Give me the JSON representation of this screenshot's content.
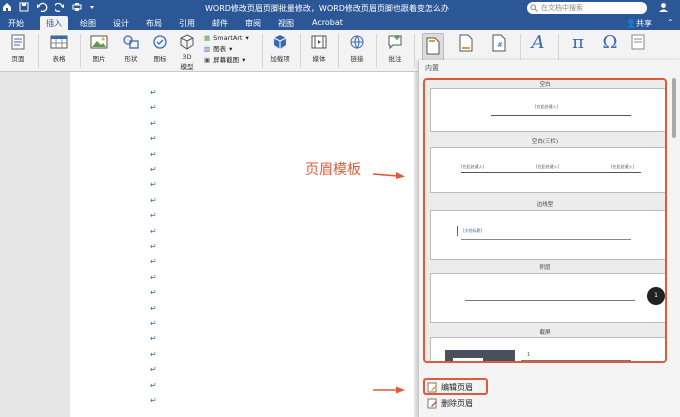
{
  "window": {
    "title": "WORD修改页眉页脚批量修改，WORD修改页眉页脚也跟着变怎么办"
  },
  "search": {
    "placeholder": "在文档中搜索"
  },
  "account": {
    "share_label": "共享"
  },
  "tabs": [
    {
      "label": "开始"
    },
    {
      "label": "插入"
    },
    {
      "label": "绘图"
    },
    {
      "label": "设计"
    },
    {
      "label": "布局"
    },
    {
      "label": "引用"
    },
    {
      "label": "邮件"
    },
    {
      "label": "审阅"
    },
    {
      "label": "视图"
    },
    {
      "label": "Acrobat"
    }
  ],
  "ribbon": {
    "page": "页面",
    "table": "表格",
    "picture": "图片",
    "shapes": "形状",
    "icons": "图标",
    "model3d_1": "3D",
    "model3d_2": "模型",
    "smartart": "SmartArt",
    "chart": "图表",
    "screenshot": "屏幕截图",
    "addins": "加载项",
    "media": "媒体",
    "link": "链接",
    "comment": "批注"
  },
  "dropdown": {
    "section_title": "内置",
    "templates": [
      {
        "label": "空白",
        "placeholder": "[在此处键入]"
      },
      {
        "label": "空白(三栏)",
        "placeholder": "[在此处键入]"
      },
      {
        "label": "边线型",
        "placeholder": "[文档标题]"
      },
      {
        "label": "积层",
        "page_number": "1"
      },
      {
        "label": "截屏",
        "page_number": "1"
      }
    ],
    "edit_header": "编辑页眉",
    "delete_header": "删除页眉"
  },
  "annotation": {
    "label": "页眉模板"
  }
}
